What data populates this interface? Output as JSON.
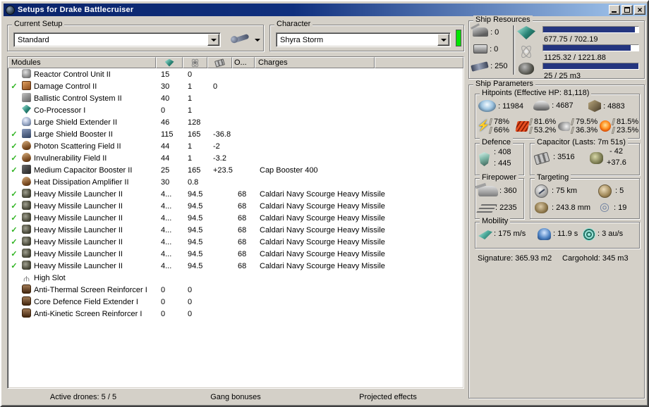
{
  "window": {
    "title": "Setups for Drake Battlecruiser"
  },
  "titlebar_buttons": {
    "minimize": "minimize",
    "maximize": "maximize",
    "close": "×"
  },
  "current_setup": {
    "label": "Current Setup",
    "value": "Standard"
  },
  "character": {
    "label": "Character",
    "value": "Shyra Storm"
  },
  "modules_table": {
    "columns": {
      "modules": "Modules",
      "cpu_icon": "cpu-icon",
      "powergrid_icon": "powergrid-icon",
      "capacitor_icon": "capacitor-icon",
      "overload": "O...",
      "charges": "Charges"
    },
    "rows": [
      {
        "fitted": false,
        "icon": "reactor",
        "name": "Reactor Control Unit II",
        "cpu": "15",
        "pg": "0",
        "cap": "",
        "o": "",
        "charge": ""
      },
      {
        "fitted": true,
        "icon": "damage",
        "name": "Damage Control II",
        "cpu": "30",
        "pg": "1",
        "cap": "0",
        "o": "",
        "charge": ""
      },
      {
        "fitted": false,
        "icon": "bcs",
        "name": "Ballistic Control System II",
        "cpu": "40",
        "pg": "1",
        "cap": "",
        "o": "",
        "charge": ""
      },
      {
        "fitted": false,
        "icon": "coproc",
        "name": "Co-Processor I",
        "cpu": "0",
        "pg": "1",
        "cap": "",
        "o": "",
        "charge": ""
      },
      {
        "fitted": false,
        "icon": "lse",
        "name": "Large Shield Extender II",
        "cpu": "46",
        "pg": "128",
        "cap": "",
        "o": "",
        "charge": ""
      },
      {
        "fitted": true,
        "icon": "lsb",
        "name": "Large Shield Booster II",
        "cpu": "115",
        "pg": "165",
        "cap": "-36.8",
        "o": "",
        "charge": ""
      },
      {
        "fitted": true,
        "icon": "hardener",
        "name": "Photon Scattering Field II",
        "cpu": "44",
        "pg": "1",
        "cap": "-2",
        "o": "",
        "charge": ""
      },
      {
        "fitted": true,
        "icon": "hardener",
        "name": "Invulnerability Field II",
        "cpu": "44",
        "pg": "1",
        "cap": "-3.2",
        "o": "",
        "charge": ""
      },
      {
        "fitted": true,
        "icon": "capbooster",
        "name": "Medium Capacitor Booster II",
        "cpu": "25",
        "pg": "165",
        "cap": "+23.5",
        "o": "",
        "charge": "Cap Booster 400"
      },
      {
        "fitted": false,
        "icon": "hardener",
        "name": "Heat Dissipation Amplifier II",
        "cpu": "30",
        "pg": "0.8",
        "cap": "",
        "o": "",
        "charge": ""
      },
      {
        "fitted": true,
        "icon": "launcher",
        "name": "Heavy Missile Launcher II",
        "cpu": "4...",
        "pg": "94.5",
        "cap": "",
        "o": "68",
        "charge": "Caldari Navy Scourge Heavy Missile"
      },
      {
        "fitted": true,
        "icon": "launcher",
        "name": "Heavy Missile Launcher II",
        "cpu": "4...",
        "pg": "94.5",
        "cap": "",
        "o": "68",
        "charge": "Caldari Navy Scourge Heavy Missile"
      },
      {
        "fitted": true,
        "icon": "launcher",
        "name": "Heavy Missile Launcher II",
        "cpu": "4...",
        "pg": "94.5",
        "cap": "",
        "o": "68",
        "charge": "Caldari Navy Scourge Heavy Missile"
      },
      {
        "fitted": true,
        "icon": "launcher",
        "name": "Heavy Missile Launcher II",
        "cpu": "4...",
        "pg": "94.5",
        "cap": "",
        "o": "68",
        "charge": "Caldari Navy Scourge Heavy Missile"
      },
      {
        "fitted": true,
        "icon": "launcher",
        "name": "Heavy Missile Launcher II",
        "cpu": "4...",
        "pg": "94.5",
        "cap": "",
        "o": "68",
        "charge": "Caldari Navy Scourge Heavy Missile"
      },
      {
        "fitted": true,
        "icon": "launcher",
        "name": "Heavy Missile Launcher II",
        "cpu": "4...",
        "pg": "94.5",
        "cap": "",
        "o": "68",
        "charge": "Caldari Navy Scourge Heavy Missile"
      },
      {
        "fitted": true,
        "icon": "launcher",
        "name": "Heavy Missile Launcher II",
        "cpu": "4...",
        "pg": "94.5",
        "cap": "",
        "o": "68",
        "charge": "Caldari Navy Scourge Heavy Missile"
      },
      {
        "fitted": false,
        "icon": "highslot",
        "name": "High Slot",
        "cpu": "",
        "pg": "",
        "cap": "",
        "o": "",
        "charge": ""
      },
      {
        "fitted": false,
        "icon": "rig",
        "name": "Anti-Thermal Screen Reinforcer I",
        "cpu": "0",
        "pg": "0",
        "cap": "",
        "o": "",
        "charge": ""
      },
      {
        "fitted": false,
        "icon": "rig",
        "name": "Core Defence Field Extender I",
        "cpu": "0",
        "pg": "0",
        "cap": "",
        "o": "",
        "charge": ""
      },
      {
        "fitted": false,
        "icon": "rig",
        "name": "Anti-Kinetic Screen Reinforcer I",
        "cpu": "0",
        "pg": "0",
        "cap": "",
        "o": "",
        "charge": ""
      }
    ]
  },
  "tabs": [
    "Active drones: 5 / 5",
    "Gang bonuses",
    "Projected effects"
  ],
  "ship_resources": {
    "label": "Ship Resources",
    "turrets": ": 0",
    "launchers": ": 0",
    "calibration": ": 250",
    "cpu": {
      "text": "677.75 / 702.19",
      "pct": 96.5
    },
    "powergrid": {
      "text": "1125.32 / 1221.88",
      "pct": 92.1
    },
    "drones": {
      "text": "25 / 25 m3",
      "pct": 100
    }
  },
  "ship_parameters": {
    "label": "Ship Parameters",
    "hitpoints": {
      "label": "Hitpoints (Effective HP: 81,118)",
      "shield": ": 11984",
      "armor": ": 4687",
      "hull": ": 4883",
      "resists": [
        {
          "name": "em",
          "top": "78%",
          "bottom": "66%"
        },
        {
          "name": "explosive",
          "top": "81.6%",
          "bottom": "53.2%"
        },
        {
          "name": "kinetic",
          "top": "79.5%",
          "bottom": "36.3%"
        },
        {
          "name": "thermal",
          "top": "81.5%",
          "bottom": "23.5%"
        }
      ]
    },
    "defence": {
      "label": "Defence",
      "v1": ": 408",
      "v2": ": 445"
    },
    "capacitor": {
      "label": "Capacitor (Lasts: 7m 51s)",
      "amount": ": 3516",
      "delta_top": "- 42",
      "delta_bottom": "+37.6"
    },
    "firepower": {
      "label": "Firepower",
      "volley": ": 360",
      "dps": ": 2235"
    },
    "targeting": {
      "label": "Targeting",
      "range": ": 75 km",
      "max_targets": ": 5",
      "scan_res": ": 243.8 mm",
      "sensor_strength": ": 19"
    },
    "mobility": {
      "label": "Mobility",
      "speed": ": 175 m/s",
      "align": ": 11.9 s",
      "warp": ": 3 au/s"
    },
    "signature": "Signature: 365.93 m2",
    "cargohold": "Cargohold: 345 m3"
  },
  "colors": {
    "titlebar_left": "#0a246a",
    "titlebar_right": "#a6caf0",
    "bar_fill": "#24357f",
    "status_green": "#00e400",
    "check_green": "#2db31f"
  }
}
